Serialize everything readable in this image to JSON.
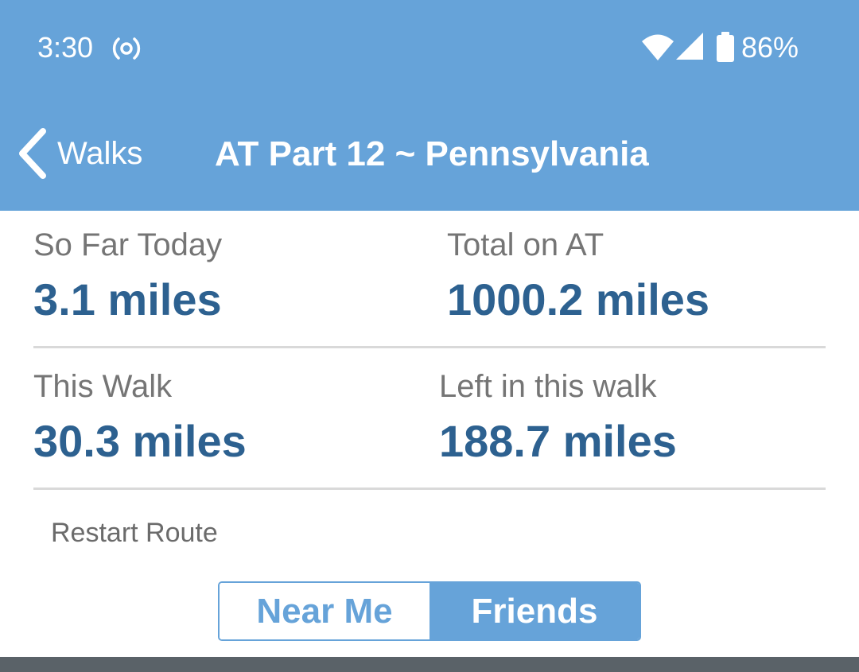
{
  "status_bar": {
    "time": "3:30",
    "battery": "86%",
    "icons": [
      "radio-broadcast-icon",
      "wifi-icon",
      "cell-signal-icon",
      "battery-icon"
    ]
  },
  "nav": {
    "back_label": "Walks",
    "title": "AT Part 12 ~ Pennsylvania"
  },
  "stats": {
    "so_far_today": {
      "label": "So Far Today",
      "value": "3.1 miles"
    },
    "total_on_at": {
      "label": "Total on AT",
      "value": "1000.2 miles"
    },
    "this_walk": {
      "label": "This Walk",
      "value": "30.3 miles"
    },
    "left_in_walk": {
      "label": "Left in this walk",
      "value": "188.7 miles"
    }
  },
  "restart_label": "Restart Route",
  "segments": {
    "near_me": "Near Me",
    "friends": "Friends",
    "selected": "Friends"
  },
  "colors": {
    "header": "#66a3d9",
    "value_text": "#2d6190",
    "label_text": "#757575",
    "bottom_bar": "#5a6268"
  }
}
